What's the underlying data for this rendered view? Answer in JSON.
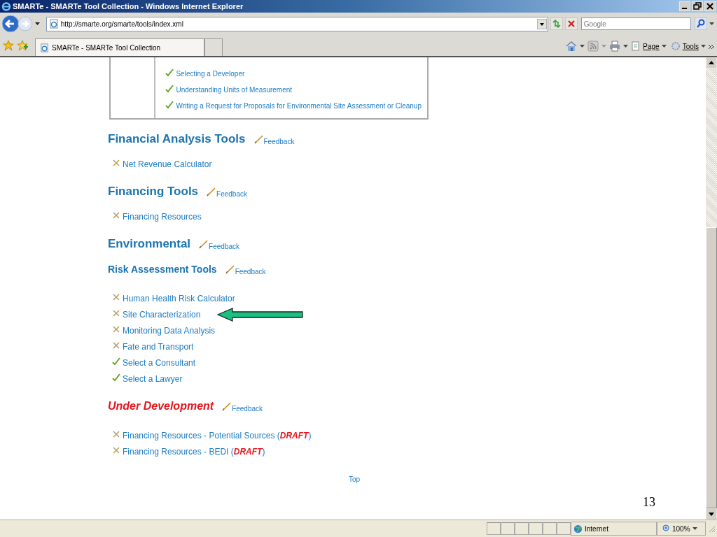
{
  "window": {
    "title": "SMARTe - SMARTe Tool Collection - Windows Internet Explorer"
  },
  "address": {
    "url": "http://smarte.org/smarte/tools/index.xml"
  },
  "search": {
    "placeholder": "Google"
  },
  "tabs": [
    {
      "label": "SMARTe - SMARTe Tool Collection",
      "selected": true
    }
  ],
  "command_bar": [
    {
      "label": "Page"
    },
    {
      "label": "Tools"
    }
  ],
  "top_table": {
    "items": [
      {
        "label": "Selecting a Developer",
        "kind": "check"
      },
      {
        "label": "Understanding Units of Measurement",
        "kind": "check"
      },
      {
        "label": "Writing a Request for Proposals for Environmental Site Assessment or Cleanup",
        "kind": "check"
      }
    ]
  },
  "sections": [
    {
      "heading": "Financial Analysis Tools",
      "kind": "heading",
      "feedback": "Feedback",
      "items": [
        {
          "label": "Net Revenue Calculator",
          "kind": "tool"
        }
      ]
    },
    {
      "heading": "Financing Tools",
      "kind": "heading",
      "feedback": "Feedback",
      "items": [
        {
          "label": "Financing Resources",
          "kind": "tool"
        }
      ]
    },
    {
      "heading": "Environmental",
      "kind": "heading",
      "feedback": "Feedback"
    },
    {
      "heading": "Risk Assessment Tools",
      "kind": "subheading",
      "feedback": "Feedback",
      "items": [
        {
          "label": "Human Health Risk Calculator",
          "kind": "tool"
        },
        {
          "label": "Site Characterization",
          "kind": "tool",
          "arrow": true
        },
        {
          "label": "Monitoring Data Analysis",
          "kind": "tool"
        },
        {
          "label": "Fate and Transport",
          "kind": "tool"
        },
        {
          "label": "Select a Consultant",
          "kind": "check"
        },
        {
          "label": "Select a Lawyer",
          "kind": "check"
        }
      ]
    },
    {
      "heading": "Under Development",
      "kind": "alert",
      "feedback": "Feedback",
      "items": [
        {
          "label": "Financing Resources - Potential Sources (",
          "draft": "DRAFT",
          "after": ")",
          "kind": "tool"
        },
        {
          "label": "Financing Resources - BEDI (",
          "draft": "DRAFT",
          "after": ")",
          "kind": "tool"
        }
      ]
    }
  ],
  "footer": {
    "link": "Top"
  },
  "slide_number": "13",
  "status_bar": {
    "zone": "Internet",
    "zoom": "100%"
  }
}
